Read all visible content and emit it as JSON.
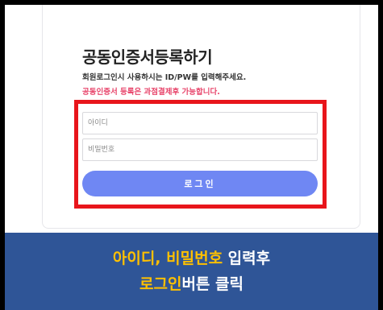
{
  "login_card": {
    "title": "공동인증서등록하기",
    "subtitle": "회원로그인시 사용하시는 ID/PW를 입력해주세요.",
    "notice": "공동인증서 등록은 과점결제후 가능합니다."
  },
  "form": {
    "id_placeholder": "아이디",
    "password_placeholder": "비밀번호",
    "login_button_label": "로그인",
    "highlight_color": "#e8151b",
    "button_color": "#6f87f3"
  },
  "instruction_banner": {
    "background_color": "#2f5597",
    "highlight_color": "#ffc000",
    "line1_highlight": "아이디, 비밀번호",
    "line1_rest": " 입력후",
    "line2_highlight": "로그인",
    "line2_rest": "버튼 클릭"
  }
}
